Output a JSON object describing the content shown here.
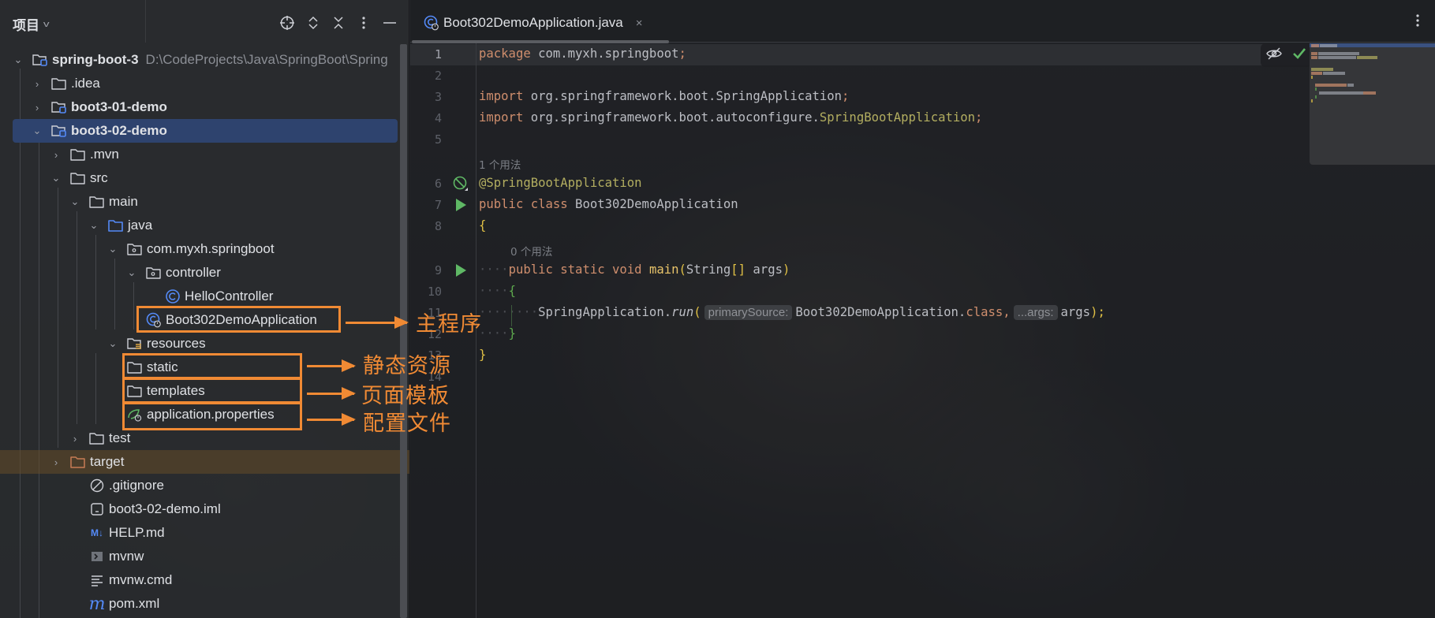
{
  "project_panel": {
    "title": "项目",
    "toolbar": {
      "locate": "target-icon",
      "expand_all": "expand-icon",
      "collapse_all": "collapse-icon",
      "options": "more-vertical-icon",
      "hide": "minimize-icon"
    },
    "tree": [
      {
        "label": "spring-boot-3",
        "path": "D:\\CodeProjects\\Java\\SpringBoot\\Spring",
        "icon": "module-folder-icon",
        "bold": true,
        "expanded": true
      },
      {
        "label": ".idea",
        "icon": "folder-icon",
        "expanded": false
      },
      {
        "label": "boot3-01-demo",
        "icon": "module-folder-icon",
        "bold": true,
        "expanded": false
      },
      {
        "label": "boot3-02-demo",
        "icon": "module-folder-icon",
        "bold": true,
        "expanded": true,
        "selected": true
      },
      {
        "label": ".mvn",
        "icon": "folder-icon",
        "expanded": false
      },
      {
        "label": "src",
        "icon": "folder-icon",
        "expanded": true
      },
      {
        "label": "main",
        "icon": "folder-icon",
        "expanded": true
      },
      {
        "label": "java",
        "icon": "source-folder-icon",
        "expanded": true
      },
      {
        "label": "com.myxh.springboot",
        "icon": "package-icon",
        "expanded": true
      },
      {
        "label": "controller",
        "icon": "package-icon",
        "expanded": true
      },
      {
        "label": "HelloController",
        "icon": "class-icon"
      },
      {
        "label": "Boot302DemoApplication",
        "icon": "spring-boot-class-icon"
      },
      {
        "label": "resources",
        "icon": "resources-folder-icon",
        "expanded": true
      },
      {
        "label": "static",
        "icon": "folder-icon"
      },
      {
        "label": "templates",
        "icon": "folder-icon"
      },
      {
        "label": "application.properties",
        "icon": "spring-properties-icon"
      },
      {
        "label": "test",
        "icon": "folder-icon",
        "expanded": false
      },
      {
        "label": "target",
        "icon": "excluded-folder-icon",
        "expanded": false
      },
      {
        "label": ".gitignore",
        "icon": "ignore-file-icon"
      },
      {
        "label": "boot3-02-demo.iml",
        "icon": "iml-file-icon"
      },
      {
        "label": "HELP.md",
        "icon": "markdown-icon"
      },
      {
        "label": "mvnw",
        "icon": "shell-script-icon"
      },
      {
        "label": "mvnw.cmd",
        "icon": "text-file-icon"
      },
      {
        "label": "pom.xml",
        "icon": "maven-icon"
      }
    ]
  },
  "annotations": {
    "main_program": "主程序",
    "static_resources": "静态资源",
    "page_templates": "页面模板",
    "config_file": "配置文件",
    "color": "#f08a34"
  },
  "editor": {
    "tab": {
      "label": "Boot302DemoApplication.java",
      "close": "×"
    },
    "line_numbers": [
      "1",
      "2",
      "3",
      "4",
      "5",
      "6",
      "7",
      "8",
      "9",
      "10",
      "11",
      "12",
      "13",
      "14"
    ],
    "usage_hints": {
      "class": "1 个用法",
      "main": "0 个用法"
    },
    "code": {
      "l1_kw": "package",
      "l1_rest": " com.myxh.springboot",
      "l1_semi": ";",
      "l3_kw": "import",
      "l3_rest": " org.springframework.boot.SpringApplication",
      "l3_semi": ";",
      "l4_kw": "import",
      "l4_rest": " org.springframework.boot.autoconfigure.",
      "l4_cls": "SpringBootApplication",
      "l4_semi": ";",
      "l6_ann": "@SpringBootApplication",
      "l7_kw": "public class",
      "l7_name": " Boot302DemoApplication",
      "l8": "{",
      "l9_kw": "public static void",
      "l9_m": "main",
      "l9_open": "(",
      "l9_type": "String",
      "l9_arr": "[]",
      "l9_arg": " args",
      "l9_close": ")",
      "l10": "{",
      "l11_cls": "SpringApplication.",
      "l11_m": "run",
      "l11_open": "(",
      "l11_hint1": "primarySource:",
      "l11_arg1": "Boot302DemoApplication.",
      "l11_kw": "class",
      "l11_comma": ",",
      "l11_hint2": "...args:",
      "l11_arg2": "args",
      "l11_close": ");",
      "l12": "}",
      "l13": "}"
    },
    "inspections": {
      "visibility": "eye-hidden-icon",
      "status": "check-icon"
    }
  }
}
